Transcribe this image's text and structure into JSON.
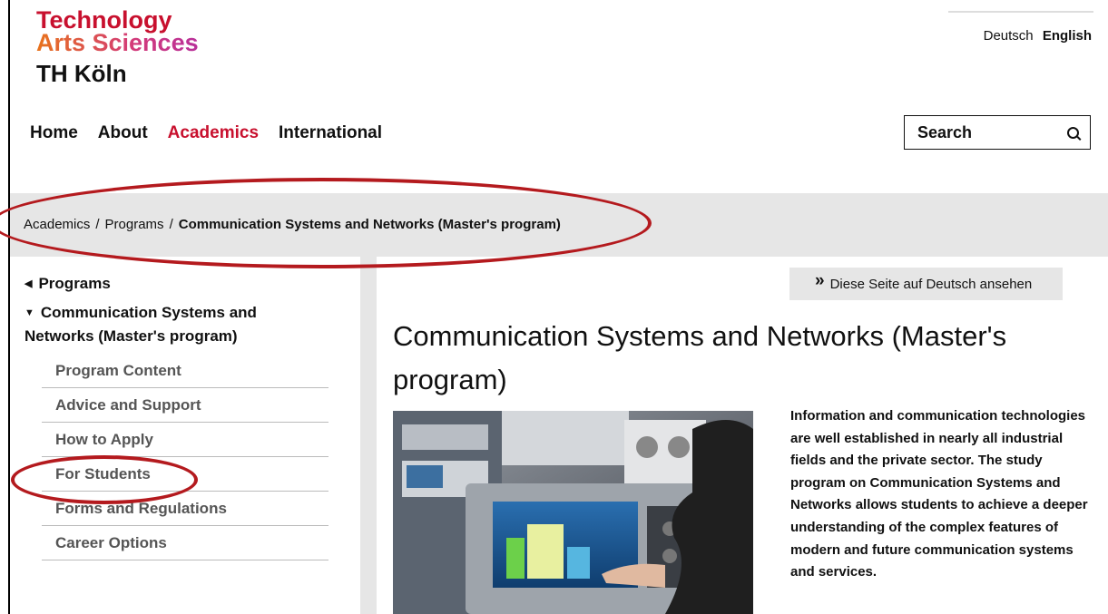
{
  "logo": {
    "line1": "Technology",
    "line2": "Arts Sciences",
    "line3": "TH Köln"
  },
  "language": {
    "deutsch": "Deutsch",
    "english": "English"
  },
  "nav": {
    "home": "Home",
    "about": "About",
    "academics": "Academics",
    "international": "International"
  },
  "search": {
    "label": "Search",
    "icon": "search-icon"
  },
  "breadcrumb": {
    "item1": "Academics",
    "item2": "Programs",
    "current": "Communication Systems and Networks (Master's program)",
    "separator": "/"
  },
  "sidebar": {
    "parent": "Programs",
    "current": "Communication Systems and Networks (Master's program)",
    "items": [
      "Program Content",
      "Advice and Support",
      "How to Apply",
      "For Students",
      "Forms and Regulations",
      "Career Options"
    ]
  },
  "lang_switch": {
    "label": "Diese Seite auf Deutsch ansehen"
  },
  "main": {
    "title": "Communication Systems and Networks (Master's program)",
    "intro": "Information and communication technologies are well established in nearly all industrial fields and the private sector. The study program on Communication Systems and Networks allows students to achieve a deeper understanding of the complex features of modern and future communication systems and services."
  },
  "colors": {
    "brand_red": "#c8102e",
    "annotation_red": "#b41a1e",
    "gray_bar": "#e6e6e6"
  }
}
